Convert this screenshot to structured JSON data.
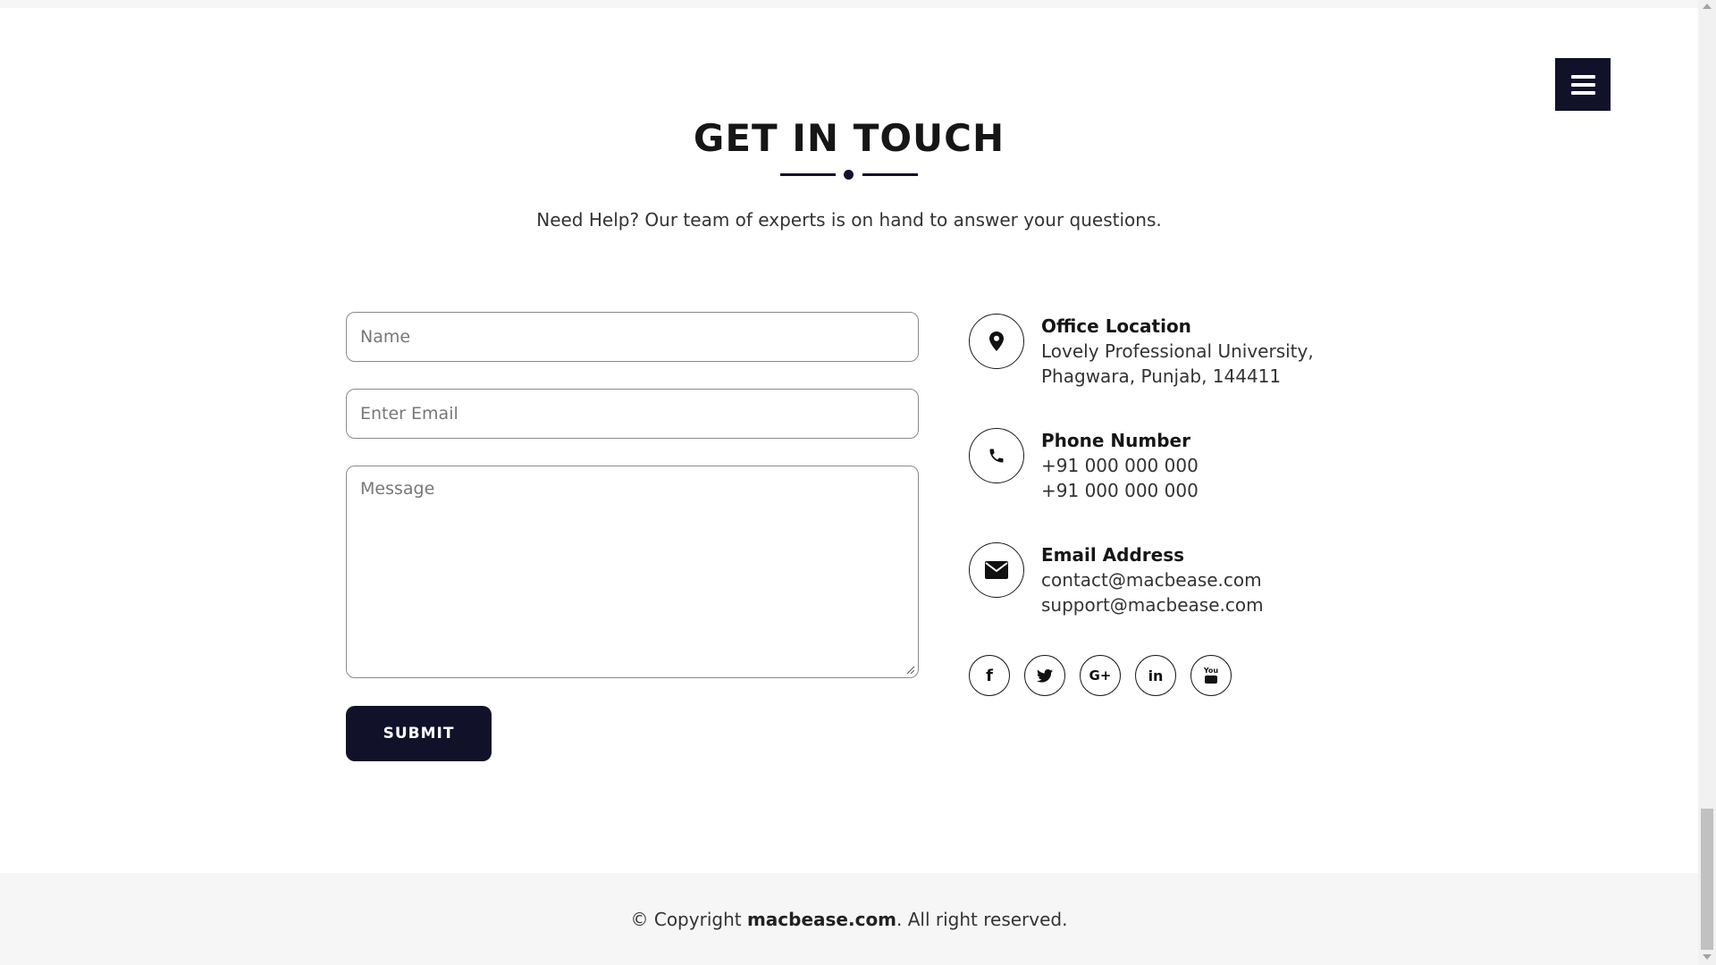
{
  "menu": {
    "icon": "hamburger-menu-icon"
  },
  "header": {
    "title": "GET IN TOUCH",
    "subtitle": "Need Help? Our team of experts is on hand to answer your questions."
  },
  "form": {
    "name_placeholder": "Name",
    "name_value": "",
    "email_placeholder": "Enter Email",
    "email_value": "",
    "message_placeholder": "Message",
    "message_value": "",
    "submit_label": "SUBMIT"
  },
  "contact": {
    "location": {
      "icon": "map-pin-icon",
      "title": "Office Location",
      "line1": "Lovely Professional University,",
      "line2": "Phagwara, Punjab, 144411"
    },
    "phone": {
      "icon": "phone-icon",
      "title": "Phone Number",
      "line1": "+91 000 000 000",
      "line2": "+91 000 000 000"
    },
    "email": {
      "icon": "envelope-icon",
      "title": "Email Address",
      "line1": "contact@macbease.com",
      "line2": "support@macbease.com"
    }
  },
  "socials": {
    "facebook": "f",
    "twitter": "twitter-icon",
    "google_plus": "G+",
    "linkedin": "in",
    "youtube_text": "You"
  },
  "footer": {
    "prefix": "© Copyright ",
    "brand": "macbease.com",
    "suffix": ". All right reserved."
  },
  "colors": {
    "accent": "#12112a",
    "footer_bg": "#f6f6f6",
    "text": "#333333"
  }
}
